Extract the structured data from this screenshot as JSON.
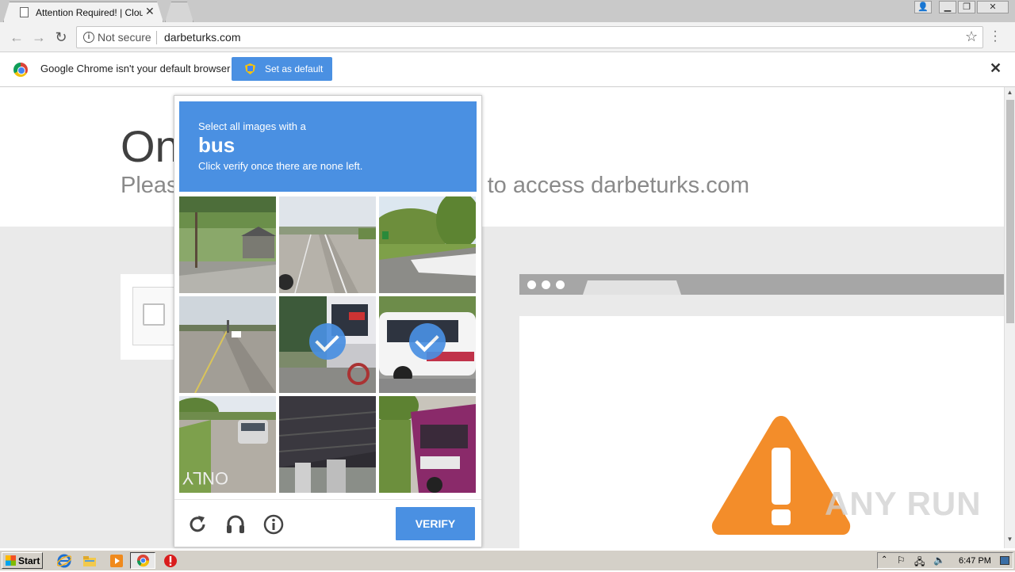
{
  "browser": {
    "tab_title": "Attention Required! | Cloudflare",
    "security_label": "Not secure",
    "url": "darbeturks.com"
  },
  "infobar": {
    "message": "Google Chrome isn't your default browser",
    "set_default_label": "Set as default"
  },
  "page": {
    "title": "One more step",
    "subtitle": "Please complete the security check to access darbeturks.com"
  },
  "captcha": {
    "prompt": "Select all images with a",
    "target": "bus",
    "instruction": "Click verify once there are none left.",
    "verify_label": "VERIFY",
    "tiles": [
      {
        "scene": "street-houses-trees",
        "selected": false
      },
      {
        "scene": "empty-highway",
        "selected": false
      },
      {
        "scene": "road-bridge-trees",
        "selected": false
      },
      {
        "scene": "highway-car",
        "selected": false
      },
      {
        "scene": "bus-front-bike",
        "selected": true
      },
      {
        "scene": "bus-side-white",
        "selected": true
      },
      {
        "scene": "road-suv-only",
        "selected": false
      },
      {
        "scene": "under-overpass",
        "selected": false
      },
      {
        "scene": "purple-bus",
        "selected": false
      }
    ]
  },
  "watermark": "ANY RUN",
  "taskbar": {
    "start_label": "Start",
    "clock": "6:47 PM"
  },
  "colors": {
    "accent_blue": "#4a90e2",
    "warning_orange": "#f38d2a"
  }
}
